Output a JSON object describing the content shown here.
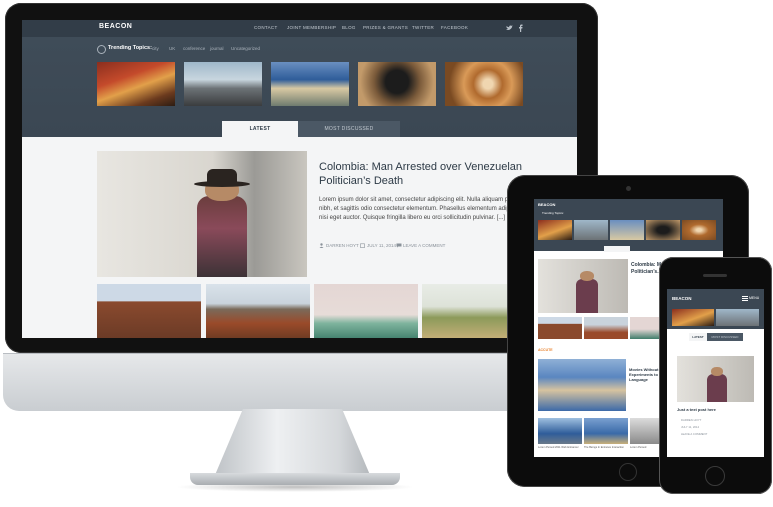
{
  "site": {
    "logo": "BEACON",
    "nav": [
      "CONTACT",
      "JOINT MEMBERSHIP",
      "BLOG",
      "PRIZES & GRANTS",
      "TWITTER",
      "FACEBOOK"
    ],
    "social_icons": [
      "twitter-icon",
      "facebook-icon"
    ],
    "colors": {
      "header": "#323d48",
      "hero": "#3f4c58",
      "accent": "#e8812c"
    }
  },
  "trending": {
    "label": "Trending Topics:",
    "tags": [
      "city",
      "UK",
      "conference",
      "journal",
      "Uncategorized"
    ]
  },
  "tabs": [
    "LATEST",
    "MOST DISCUSSED"
  ],
  "article": {
    "title": "Colombia: Man Arrested over Venezuelan Politician’s Death",
    "body": "Lorem ipsum dolor sit amet, consectetur adipiscing elit. Nulla aliquam purus nibh, et sagittis odio consectetur elementum. Phasellus elementum adipiscing nisi eget auctor. Quisque fringilla libero eu orci sollicitudin pulvinar. [...]",
    "author": "DARREN HOYT",
    "date": "JULY 11, 2014",
    "comments": "LEAVE A COMMENT"
  },
  "ipad": {
    "logo": "BEACON",
    "trending_label": "Trending Topics:",
    "article_title": "Colombia: Ma... Arrested ov... Politician’s...",
    "section_label": "ACCUTE",
    "side_title": "Movies Without Experiments to Language",
    "captions": [
      "Lorem Pursed 2011 Web Entrancer",
      "The Beings In Entrance Interaction",
      "Lorem Pursed"
    ]
  },
  "iphone": {
    "logo": "BEACON",
    "menu": "MENU",
    "tabs": [
      "LATEST",
      "MOST DISCUSSED"
    ],
    "post_title": "Just a text post here",
    "meta": [
      "DARREN HOYT",
      "JULY 11, 2014",
      "LEAVE A COMMENT"
    ]
  }
}
